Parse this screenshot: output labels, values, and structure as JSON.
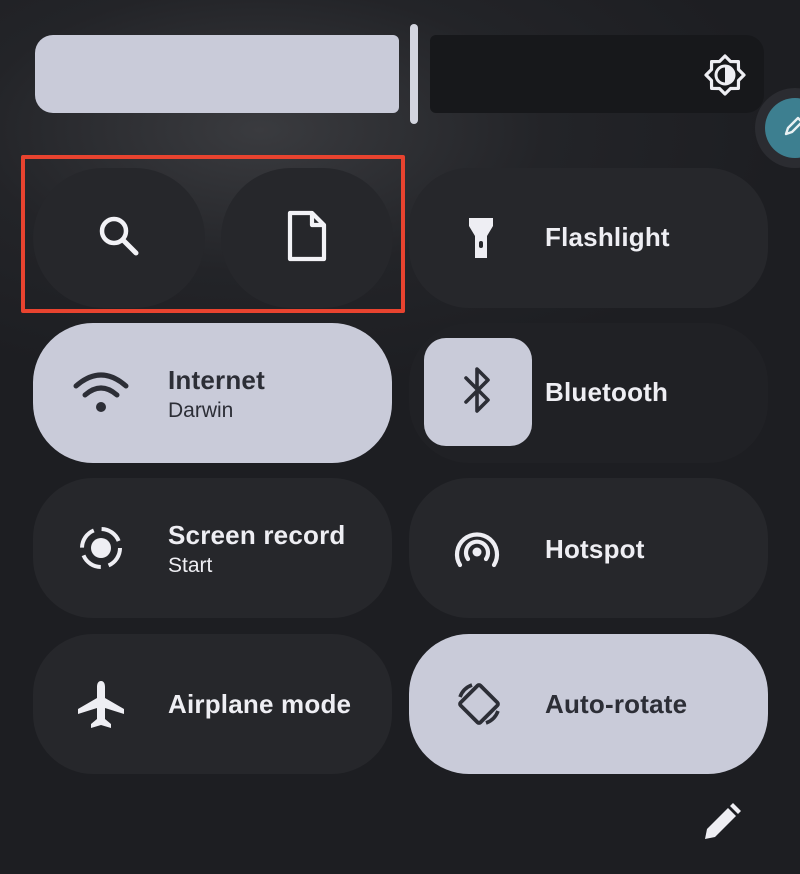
{
  "brightness": {
    "level": 0.5,
    "icon": "brightness-icon"
  },
  "side_button": {
    "icon": "pencil-icon"
  },
  "shortcuts": [
    {
      "id": "search",
      "icon": "search-icon"
    },
    {
      "id": "document",
      "icon": "document-icon"
    }
  ],
  "tiles": {
    "flashlight": {
      "label": "Flashlight",
      "icon": "flashlight-icon",
      "state": "off"
    },
    "internet": {
      "label": "Internet",
      "subtitle": "Darwin",
      "icon": "wifi-icon",
      "state": "on"
    },
    "bluetooth": {
      "label": "Bluetooth",
      "icon": "bluetooth-icon",
      "state": "on"
    },
    "screen_record": {
      "label": "Screen record",
      "subtitle": "Start",
      "icon": "screen-record-icon",
      "state": "off"
    },
    "hotspot": {
      "label": "Hotspot",
      "icon": "hotspot-icon",
      "state": "off"
    },
    "airplane": {
      "label": "Airplane mode",
      "icon": "airplane-icon",
      "state": "off"
    },
    "auto_rotate": {
      "label": "Auto-rotate",
      "icon": "auto-rotate-icon",
      "state": "on"
    }
  },
  "footer": {
    "edit_icon": "edit-icon"
  },
  "colors": {
    "tile_dark": "#26272b",
    "tile_light": "#c9cbd9",
    "highlight": "#e8432f",
    "accent": "#3d7f90"
  }
}
